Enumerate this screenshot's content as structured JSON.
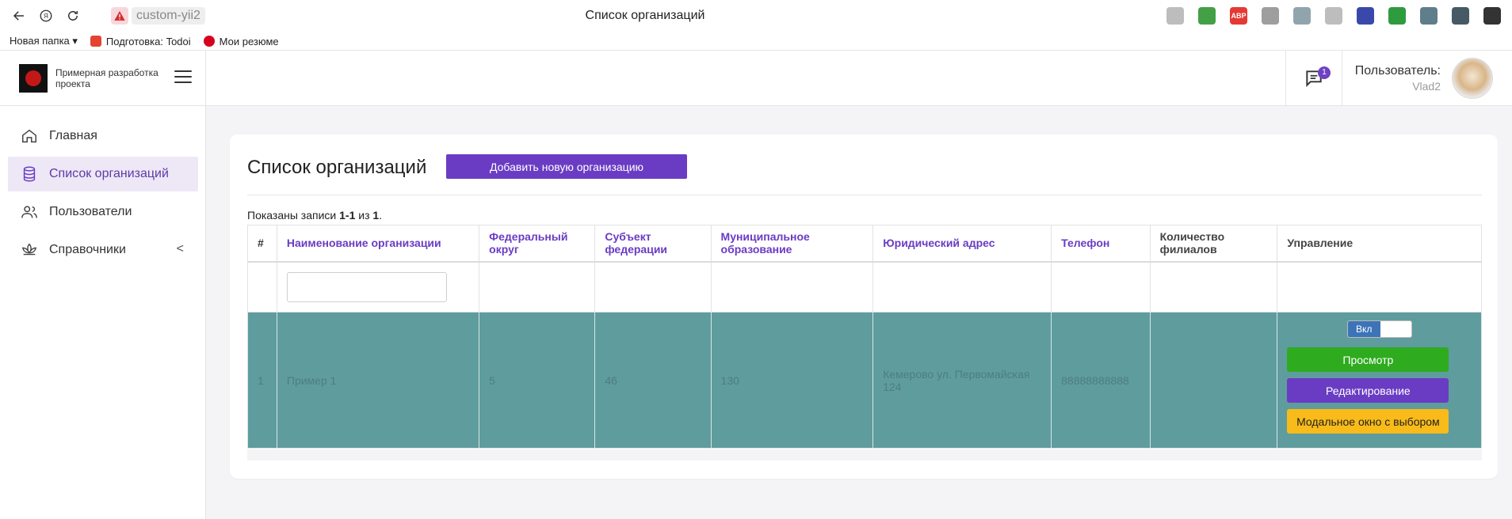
{
  "browser": {
    "host": "custom-yii2",
    "tab_title": "Список организаций",
    "bookmarks": [
      {
        "label": "Новая папка ▾",
        "icon": "folder-icon"
      },
      {
        "label": "Подготовка: Todoi",
        "icon": "todoist-icon",
        "color": "#e44332"
      },
      {
        "label": "Мои резюме",
        "icon": "hh-icon",
        "color": "#d6001c"
      }
    ],
    "extensions": [
      {
        "name": "bookmark-icon",
        "color": "#bdbdbd",
        "text": ""
      },
      {
        "name": "download-ext-icon",
        "color": "#43a047",
        "text": ""
      },
      {
        "name": "abp-icon",
        "color": "#e53935",
        "text": "ABP"
      },
      {
        "name": "ext-mask-icon",
        "color": "#9e9e9e",
        "text": ""
      },
      {
        "name": "ext-user-icon",
        "color": "#90a4ae",
        "text": ""
      },
      {
        "name": "ext-dog-icon",
        "color": "#bdbdbd",
        "text": ""
      },
      {
        "name": "ext-color-icon",
        "color": "#3949ab",
        "text": ""
      },
      {
        "name": "shield-check-icon",
        "color": "#2e9c3e",
        "text": ""
      },
      {
        "name": "vpn-icon",
        "color": "#607d8b",
        "text": ""
      },
      {
        "name": "extensions-icon",
        "color": "#455a64",
        "text": ""
      },
      {
        "name": "downloads-icon",
        "color": "#333333",
        "text": ""
      }
    ]
  },
  "header": {
    "project_title": "Примерная разработка проекта",
    "messages_count": "1",
    "user_label": "Пользователь:",
    "user_name": "Vlad2"
  },
  "sidebar": {
    "items": [
      {
        "label": "Главная",
        "icon": "home-icon",
        "active": false
      },
      {
        "label": "Список организаций",
        "icon": "database-icon",
        "active": true
      },
      {
        "label": "Пользователи",
        "icon": "users-icon",
        "active": false
      },
      {
        "label": "Справочники",
        "icon": "lotus-icon",
        "active": false,
        "chevron": "<"
      }
    ]
  },
  "main": {
    "title": "Список организаций",
    "add_button": "Добавить новую организацию",
    "summary_prefix": "Показаны записи ",
    "summary_range": "1-1",
    "summary_mid": " из ",
    "summary_total": "1",
    "summary_suffix": ".",
    "columns": [
      "#",
      "Наименование организации",
      "Федеральный округ",
      "Субъект федерации",
      "Муниципальное образование",
      "Юридический адрес",
      "Телефон",
      "Количество филиалов",
      "Управление"
    ],
    "rows": [
      {
        "num": "1",
        "name": "Пример 1",
        "district": "5",
        "subject": "46",
        "municipality": "130",
        "address": "Кемерово ул. Первомайская 124",
        "phone": "88888888888",
        "branches": "",
        "toggle_label": "Вкл",
        "view_label": "Просмотр",
        "edit_label": "Редактирование",
        "modal_label": "Модальное окно с выбором"
      }
    ]
  },
  "colors": {
    "accent": "#6a3cc3",
    "row_highlight": "#5f9c9e",
    "view_button": "#2fab1f",
    "modal_button": "#f8bb1a"
  }
}
